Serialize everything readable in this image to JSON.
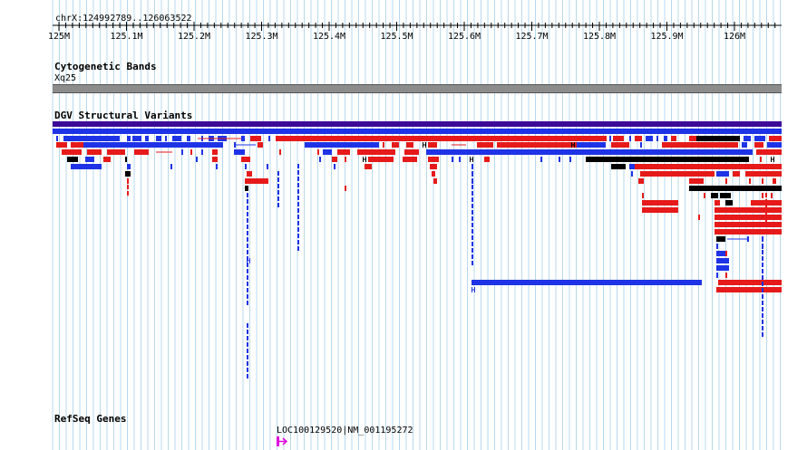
{
  "location": "chrX:124992789..126063522",
  "ruler_ticks": [
    "125M",
    "125.1M",
    "125.2M",
    "125.3M",
    "125.4M",
    "125.5M",
    "125.6M",
    "125.7M",
    "125.8M",
    "125.9M",
    "126M"
  ],
  "tracks": {
    "cytoband": {
      "title": "Cytogenetic Bands",
      "band_label": "Xq25"
    },
    "dgv": {
      "title": "DGV Structural Variants"
    },
    "refseq": {
      "title": "RefSeq Genes",
      "gene_label": "LOC100129520|NM_001195272"
    }
  },
  "colors": {
    "grid": "#b8d8ec",
    "summary_bar": "#3c0a96",
    "loss": "#1f33e6",
    "gain": "#e61a1a",
    "gain_loss": "#000000",
    "cytoband": "#8c8c8c",
    "gene": "#e000e0"
  },
  "icons": {
    "gene_strand": "forward-arrow-icon"
  }
}
